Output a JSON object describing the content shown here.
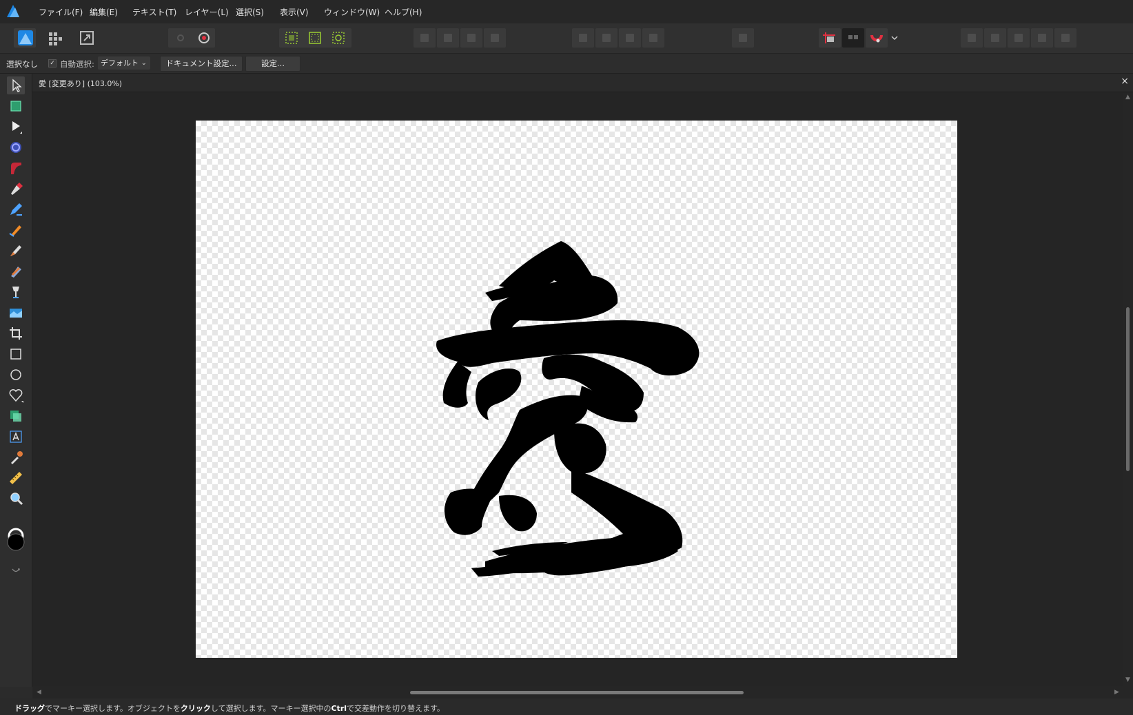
{
  "menu": {
    "items": [
      "ファイル(F)",
      "編集(E)",
      "テキスト(T)",
      "レイヤー(L)",
      "選択(S)",
      "表示(V)",
      "ウィンドウ(W)",
      "ヘルプ(H)"
    ]
  },
  "context_bar": {
    "selection_label": "選択なし",
    "auto_select_label": "自動選択:",
    "auto_select_checked": true,
    "preset_value": "デフォルト",
    "document_settings_button": "ドキュメント設定...",
    "settings_button": "設定..."
  },
  "document": {
    "title": "愛 [変更あり] (103.0%)",
    "zoom_percent": 103.0
  },
  "status": {
    "drag_bold": "ドラッグ",
    "part1": "でマーキー選択します。オブジェクトを",
    "click_bold": "クリック",
    "part2": "して選択します。マーキー選択中の",
    "ctrl_bold": "Ctrl",
    "part3": "で交差動作を切り替えます。"
  },
  "colors": {
    "accent": "#1e88e5",
    "snapping_red": "#e03040",
    "menubar_bg": "#272727",
    "canvas_bg": "#252525"
  },
  "icons": {
    "app": "affinity-designer-icon",
    "personas": [
      "designer-persona-icon",
      "pixel-persona-icon",
      "export-persona-icon"
    ],
    "tools": [
      "move-tool-icon",
      "artboard-tool-icon",
      "node-tool-icon",
      "point-transform-tool-icon",
      "corner-tool-icon",
      "pen-tool-icon",
      "pencil-tool-icon",
      "vector-brush-tool-icon",
      "fill-tool-icon",
      "transparency-tool-icon",
      "place-image-tool-icon",
      "vector-crop-tool-icon",
      "rectangle-tool-icon",
      "ellipse-tool-icon",
      "heart-shape-tool-icon",
      "shape-builder-tool-icon",
      "artistic-text-tool-icon",
      "color-picker-tool-icon",
      "measure-tool-icon",
      "zoom-tool-icon"
    ]
  }
}
